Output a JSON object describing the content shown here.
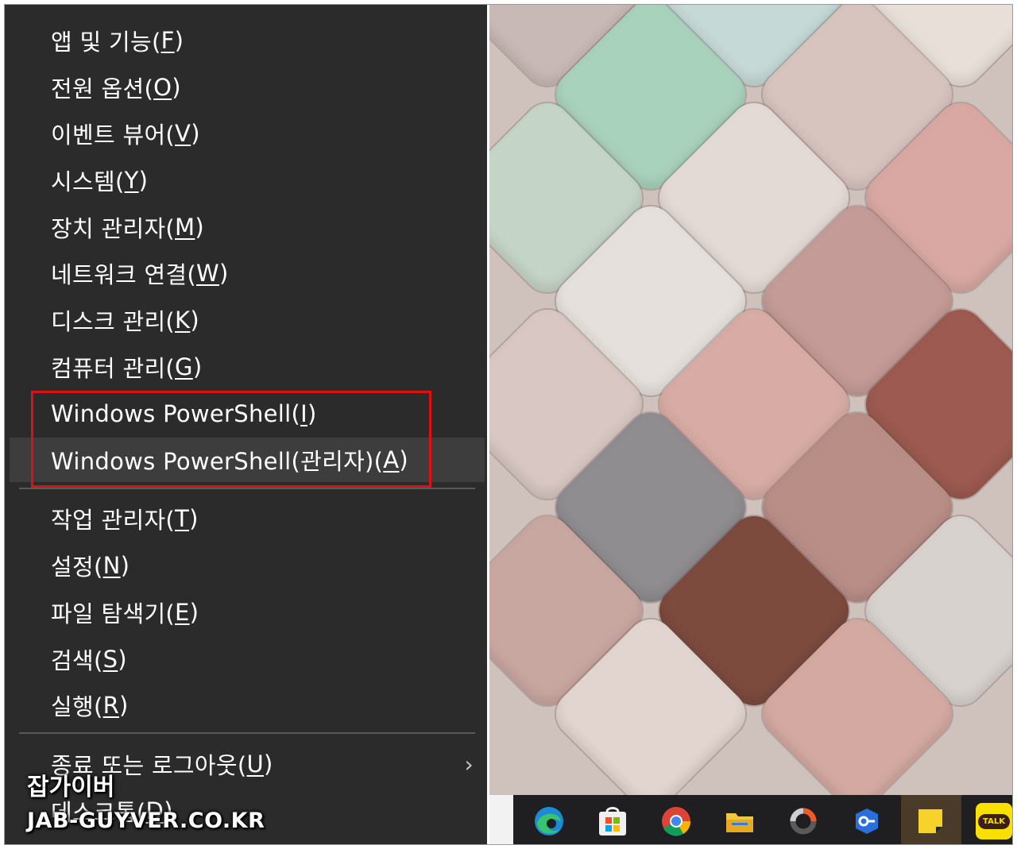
{
  "menu": {
    "items": [
      {
        "label": "앱 및 기능(",
        "key": "F",
        "tail": ")"
      },
      {
        "label": "전원 옵션(",
        "key": "O",
        "tail": ")"
      },
      {
        "label": "이벤트 뷰어(",
        "key": "V",
        "tail": ")"
      },
      {
        "label": "시스템(",
        "key": "Y",
        "tail": ")"
      },
      {
        "label": "장치 관리자(",
        "key": "M",
        "tail": ")"
      },
      {
        "label": "네트워크 연결(",
        "key": "W",
        "tail": ")"
      },
      {
        "label": "디스크 관리(",
        "key": "K",
        "tail": ")"
      },
      {
        "label": "컴퓨터 관리(",
        "key": "G",
        "tail": ")"
      },
      {
        "label": "Windows PowerShell(",
        "key": "I",
        "tail": ")"
      },
      {
        "label": "Windows PowerShell(관리자)(",
        "key": "A",
        "tail": ")"
      },
      {
        "label": "작업 관리자(",
        "key": "T",
        "tail": ")"
      },
      {
        "label": "설정(",
        "key": "N",
        "tail": ")"
      },
      {
        "label": "파일 탐색기(",
        "key": "E",
        "tail": ")"
      },
      {
        "label": "검색(",
        "key": "S",
        "tail": ")"
      },
      {
        "label": "실행(",
        "key": "R",
        "tail": ")"
      },
      {
        "label": "종료 또는 로그아웃(",
        "key": "U",
        "tail": ")"
      },
      {
        "label": "데스크톱(",
        "key": "D",
        "tail": ")"
      }
    ],
    "submenu_arrow": "›"
  },
  "taskbar": {
    "icons": [
      "edge-icon",
      "microsoft-store-icon",
      "chrome-icon",
      "file-explorer-icon",
      "app-loader-icon",
      "security-key-icon",
      "sticky-notes-icon",
      "kakaotalk-icon"
    ],
    "kakaotalk_label": "TALK"
  },
  "watermark": {
    "name": "잡가이버",
    "url": "JAB-GUYVER.CO.KR"
  },
  "colors": {
    "menu_bg": "#2b2b2b",
    "hover_bg": "#3d3d3d",
    "highlight_border": "#e01010",
    "taskbar_bg": "#1f1f22"
  }
}
